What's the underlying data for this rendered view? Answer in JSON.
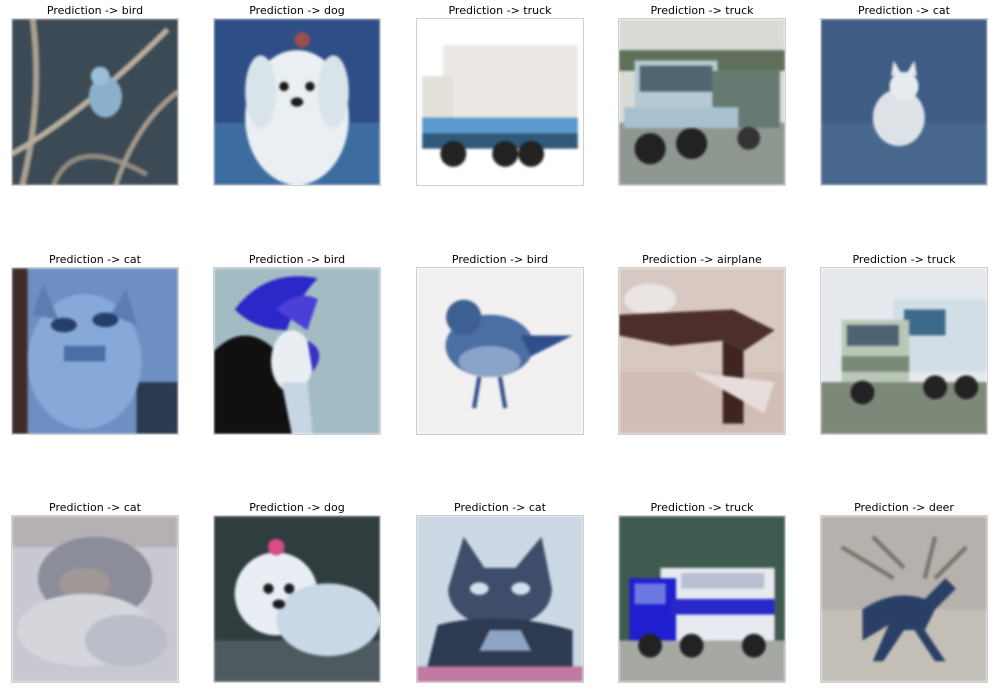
{
  "figure": {
    "images": [
      {
        "title": "Prediction -> bird",
        "subject": "bird"
      },
      {
        "title": "Prediction -> dog",
        "subject": "dog"
      },
      {
        "title": "Prediction -> truck",
        "subject": "truck"
      },
      {
        "title": "Prediction -> truck",
        "subject": "truck"
      },
      {
        "title": "Prediction -> cat",
        "subject": "cat"
      },
      {
        "title": "Prediction -> cat",
        "subject": "cat"
      },
      {
        "title": "Prediction -> bird",
        "subject": "bird"
      },
      {
        "title": "Prediction -> bird",
        "subject": "bird"
      },
      {
        "title": "Prediction -> airplane",
        "subject": "airplane"
      },
      {
        "title": "Prediction -> truck",
        "subject": "truck"
      },
      {
        "title": "Prediction -> cat",
        "subject": "cat"
      },
      {
        "title": "Prediction -> dog",
        "subject": "dog"
      },
      {
        "title": "Prediction -> cat",
        "subject": "cat"
      },
      {
        "title": "Prediction -> truck",
        "subject": "truck"
      },
      {
        "title": "Prediction -> deer",
        "subject": "deer"
      }
    ]
  }
}
